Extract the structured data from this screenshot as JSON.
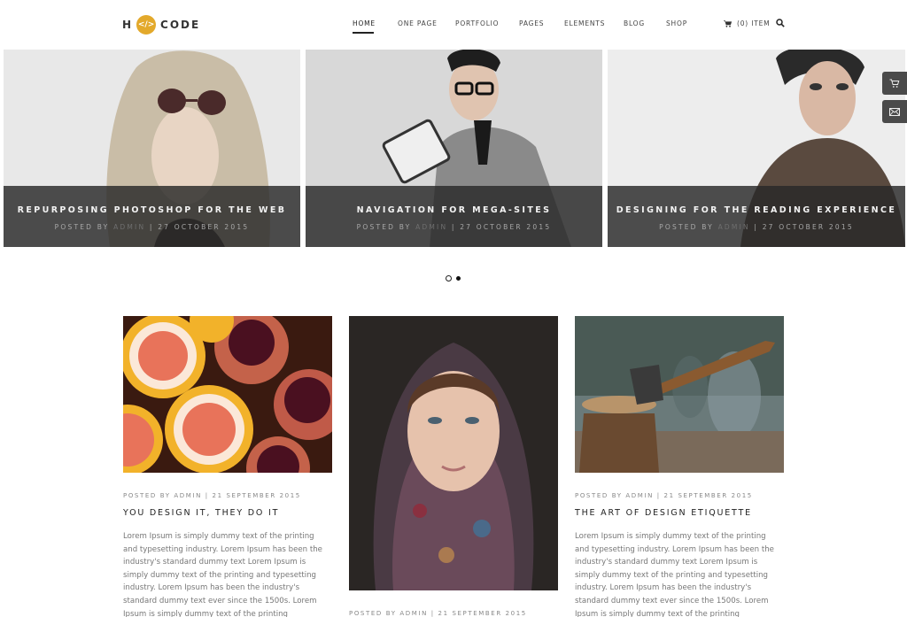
{
  "header": {
    "logo": {
      "left": "H",
      "badge": "</>",
      "right": "CODE"
    },
    "nav": [
      {
        "label": "HOME",
        "active": true
      },
      {
        "label": "ONE PAGE",
        "active": false
      },
      {
        "label": "PORTFOLIO",
        "active": false
      },
      {
        "label": "PAGES",
        "active": false
      },
      {
        "label": "ELEMENTS",
        "active": false
      },
      {
        "label": "BLOG",
        "active": false
      },
      {
        "label": "SHOP",
        "active": false
      }
    ],
    "cart_label": "(0) ITEM",
    "icons": {
      "cart": "cart-icon",
      "search": "search-icon"
    }
  },
  "slider": {
    "slides": [
      {
        "title": "REPURPOSING PHOTOSHOP FOR THE WEB",
        "posted_by": "POSTED BY",
        "author": "ADMIN",
        "separator": "|",
        "date": "27 OCTOBER 2015",
        "image": "woman-with-sunglasses"
      },
      {
        "title": "NAVIGATION FOR MEGA-SITES",
        "posted_by": "POSTED BY",
        "author": "ADMIN",
        "separator": "|",
        "date": "27 OCTOBER 2015",
        "image": "man-with-radio"
      },
      {
        "title": "DESIGNING FOR THE READING EXPERIENCE",
        "posted_by": "POSTED BY",
        "author": "ADMIN",
        "separator": "|",
        "date": "27 OCTOBER 2015",
        "image": "woman-portrait"
      }
    ],
    "dots": {
      "count": 2,
      "active_index": 1
    }
  },
  "side_buttons": [
    {
      "icon": "cart-icon"
    },
    {
      "icon": "mail-icon"
    }
  ],
  "posts": [
    {
      "meta": "POSTED BY ADMIN | 21 SEPTEMBER 2015",
      "title": "YOU DESIGN IT, THEY DO IT",
      "body": "Lorem Ipsum is simply dummy text of the printing and typesetting industry. Lorem Ipsum has been the industry's standard dummy text Lorem Ipsum is simply dummy text of the printing and typesetting industry. Lorem Ipsum has been the industry's standard dummy text ever since the 1500s. Lorem Ipsum is simply dummy text of the printing",
      "image": "grapefruit-and-pomegranates"
    },
    {
      "meta": "POSTED BY ADMIN | 21 SEPTEMBER 2015",
      "title": "",
      "body": "",
      "image": "woman-with-headscarf"
    },
    {
      "meta": "POSTED BY ADMIN | 21 SEPTEMBER 2015",
      "title": "THE ART OF DESIGN ETIQUETTE",
      "body": "Lorem Ipsum is simply dummy text of the printing and typesetting industry. Lorem Ipsum has been the industry's standard dummy text Lorem Ipsum is simply dummy text of the printing and typesetting industry. Lorem Ipsum has been the industry's standard dummy text ever since the 1500s. Lorem Ipsum is simply dummy text of the printing",
      "image": "axe-in-tree-stump"
    }
  ],
  "colors": {
    "accent": "#e3a92b",
    "caption_bg": "#3a3a3a",
    "text_dark": "#222222",
    "text_muted": "#777777"
  }
}
